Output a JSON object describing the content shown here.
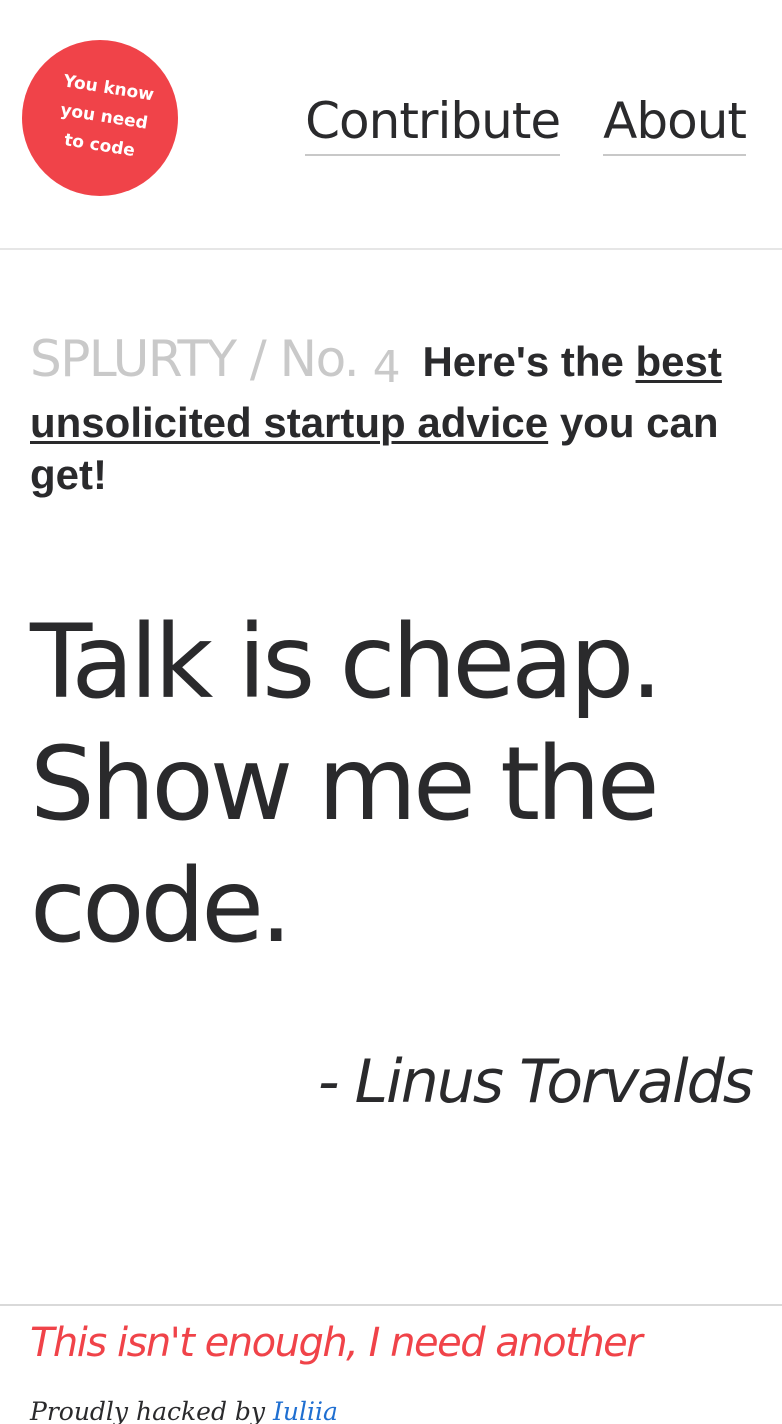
{
  "header": {
    "logo": {
      "lines": [
        "You know",
        "you need",
        "to code"
      ],
      "color": "#f04349"
    },
    "nav": [
      {
        "label": "Contribute"
      },
      {
        "label": "About"
      }
    ]
  },
  "intro": {
    "brand": "SPLURTY / No.",
    "number": "4",
    "text_before": "Here's the",
    "link_text": "best unsolicited startup advice",
    "text_after": "you can get!"
  },
  "quote": {
    "text": "Talk is cheap. Show me the code.",
    "author": "- Linus Torvalds"
  },
  "footer": {
    "another_link": "This isn't enough, I need another",
    "credits_prefix": "Proudly hacked by",
    "credits_author": "Iuliia"
  },
  "colors": {
    "accent": "#f04349",
    "text": "#2a2a2c",
    "muted": "#c9c9c9",
    "link_blue": "#1f6fd1"
  }
}
